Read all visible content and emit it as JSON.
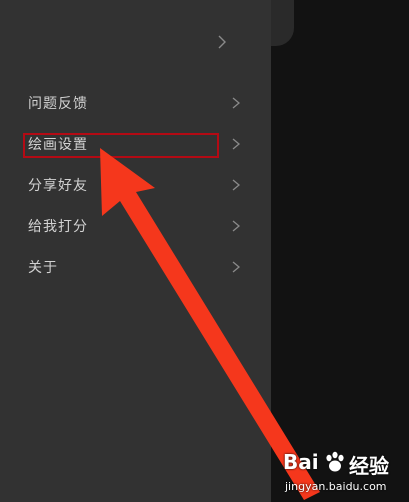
{
  "menu": {
    "items": [
      {
        "label": "问题反馈"
      },
      {
        "label": "绘画设置"
      },
      {
        "label": "分享好友"
      },
      {
        "label": "给我打分"
      },
      {
        "label": "关于"
      }
    ]
  },
  "watermark": {
    "brand_left": "Bai",
    "brand_right": "经验",
    "url": "jingyan.baidu.com"
  },
  "colors": {
    "panel": "#323232",
    "backdrop": "#121212",
    "text": "#d2d2d2",
    "highlight": "#b40a14",
    "arrow": "#f5371c"
  }
}
